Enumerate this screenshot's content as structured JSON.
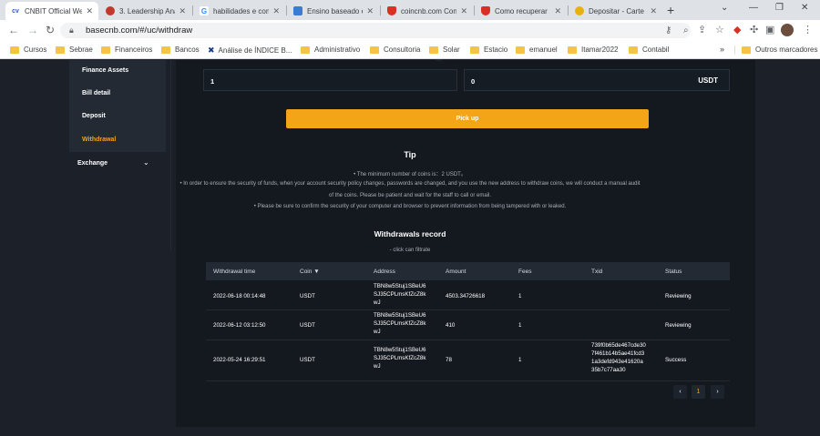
{
  "browser": {
    "tabs": [
      {
        "title": "CNBIT Official We",
        "active": true,
        "icon": "cnbit-icon"
      },
      {
        "title": "3. Leadership Ana",
        "active": false,
        "icon": "leadership-icon"
      },
      {
        "title": "habilidades e com",
        "active": false,
        "icon": "google-icon"
      },
      {
        "title": "Ensino baseado e",
        "active": false,
        "icon": "ensino-icon"
      },
      {
        "title": "coincnb.com Con",
        "active": false,
        "icon": "shield-icon"
      },
      {
        "title": "Como recuperar",
        "active": false,
        "icon": "shield-icon"
      },
      {
        "title": "Depositar - Carte",
        "active": false,
        "icon": "coin-icon"
      }
    ],
    "url": "basecnb.com/#/uc/withdraw",
    "bookmarks": [
      "Cursos",
      "Sebrae",
      "Financeiros",
      "Bancos",
      "Análise de ÍNDICE B...",
      "Administrativo",
      "Consultoria",
      "Solar",
      "Estacio",
      "emanuel",
      "Itamar2022",
      "Contabil"
    ],
    "bookmarks_more": "»",
    "other_bookmarks": "Outros marcadores"
  },
  "sidebar": {
    "items": [
      "Finance Assets",
      "Bill detail",
      "Deposit",
      "Withdrawal"
    ],
    "active": "Withdrawal",
    "exchange": "Exchange"
  },
  "form": {
    "top_label": "∙∙∙∙",
    "amount_value": "1",
    "fee_value": "0",
    "unit": "USDT",
    "pickup_label": "Pick up"
  },
  "tip": {
    "title": "Tip",
    "lines": [
      "• The minimum number of coins is：2 USDT。",
      "• In order to ensure the security of funds, when your account security policy changes, passwords are changed, and you use the new address to withdraw coins, we will conduct a manual audit",
      "of the coins. Please be patient and wait for the staff to call or email.",
      "• Please be sure to confirm the security of your computer and browser to prevent information from being tampered with or leaked."
    ]
  },
  "records": {
    "title": "Withdrawals record",
    "hint": "- click can filtrate",
    "headers": [
      "Withdrawal time",
      "Coin",
      "Address",
      "Amount",
      "Fees",
      "Txid",
      "Status"
    ],
    "rows": [
      {
        "time": "2022-06-18 00:14:48",
        "coin": "USDT",
        "address": [
          "TBN8w5Stuj1SBeU6",
          "SJ35CPLmsKfZcZ8k",
          "wJ"
        ],
        "amount": "4503.34726618",
        "fees": "1",
        "txid": [],
        "status": "Reviewing"
      },
      {
        "time": "2022-06-12 03:12:50",
        "coin": "USDT",
        "address": [
          "TBN8w5Stuj1SBeU6",
          "SJ35CPLmsKfZcZ8k",
          "wJ"
        ],
        "amount": "410",
        "fees": "1",
        "txid": [],
        "status": "Reviewing"
      },
      {
        "time": "2022-05-24 16:29:51",
        "coin": "USDT",
        "address": [
          "TBN8w5Stuj1SBeU6",
          "SJ35CPLmsKfZcZ8k",
          "wJ"
        ],
        "amount": "78",
        "fees": "1",
        "txid": [
          "739f0b65de467cde30",
          "7f461b14b5ae41fcd3",
          "1a3defd943e41620a",
          "35b7c77aa30"
        ],
        "status": "Success"
      }
    ],
    "pagination": {
      "prev": "‹",
      "page": "1",
      "next": "›"
    }
  },
  "colors": {
    "accent": "#f3a517",
    "page_bg": "#1b2029",
    "panel_bg": "#141920"
  }
}
